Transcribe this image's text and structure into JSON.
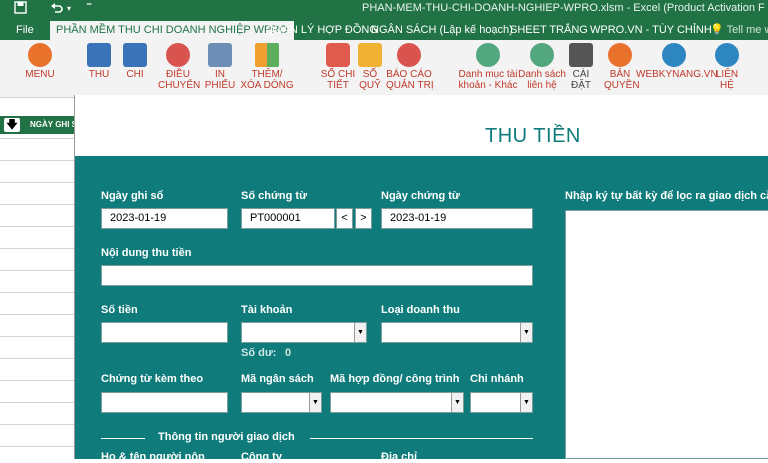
{
  "titlebar": {
    "save_icon": "save-icon",
    "undo_icon": "undo-icon",
    "title": "PHAN-MEM-THU-CHI-DOANH-NGHIEP-WPRO.xlsm - Excel (Product Activation F"
  },
  "tabs": [
    {
      "label": "File"
    },
    {
      "label": "PHẦN MỀM THU CHI DOANH NGHIỆP WPRO"
    },
    {
      "label": "QUẢN LÝ HỢP ĐỒNG"
    },
    {
      "label": "NGÂN SÁCH (Lập kế hoạch)"
    },
    {
      "label": "SHEET TRẮNG"
    },
    {
      "label": "WPRO.VN - TÙY CHỈNH"
    },
    {
      "label": "Tell me wha"
    }
  ],
  "ribbon": [
    {
      "label": "MENU",
      "icon": "menu-icon"
    },
    {
      "label": "THU",
      "icon": "monitor-icon"
    },
    {
      "label": "CHI",
      "icon": "monitor-icon"
    },
    {
      "label": "ĐIỀU\nCHUYỂN",
      "icon": "transfer-icon"
    },
    {
      "label": "IN\nPHIẾU",
      "icon": "printer-icon"
    },
    {
      "label": "THÊM/\nXÓA DÒNG",
      "icon": "grid-icon"
    },
    {
      "label": "SỔ CHI\nTIẾT",
      "icon": "document-icon"
    },
    {
      "label": "SỔ\nQUỸ",
      "icon": "folder-icon"
    },
    {
      "label": "BÁO CÁO\nQUẢN TRỊ",
      "icon": "chart-icon"
    },
    {
      "label": "Danh mục tài\nkhoản - Khác",
      "icon": "list-icon"
    },
    {
      "label": "Danh sách\nliên hệ",
      "icon": "list-icon"
    },
    {
      "label": "CÀI\nĐẶT",
      "icon": "settings-icon"
    },
    {
      "label": "BẢN\nQUYỀN",
      "icon": "license-icon"
    },
    {
      "label": "WEBKYNANG.VN",
      "icon": "globe-icon"
    },
    {
      "label": "LIÊN\nHỆ",
      "icon": "contact-icon"
    }
  ],
  "sheet": {
    "column_header": "NGÀY GHI S"
  },
  "form": {
    "title": "THU TIỀN",
    "labels": {
      "ngay_ghi_so": "Ngày ghi sổ",
      "so_chung_tu": "Số chứng từ",
      "ngay_chung_tu": "Ngày chứng từ",
      "noi_dung": "Nội dung thu tiền",
      "so_tien": "Số tiền",
      "tai_khoan": "Tài khoản",
      "loai_doanh_thu": "Loại doanh thu",
      "so_du": "Số dư:",
      "so_du_value": "0",
      "chung_tu_kem_theo": "Chứng từ kèm theo",
      "ma_ngan_sach": "Mã ngân sách",
      "ma_hop_dong": "Mã hợp đồng/ công trình",
      "chi_nhanh": "Chi nhánh",
      "thong_tin": "Thông tin người giao dịch",
      "ho_ten": "Họ & tên người nộp",
      "cong_ty": "Công ty",
      "dia_chi": "Địa chỉ",
      "filter_hint": "Nhập ký tự bất kỳ để lọc ra giao dịch cầ"
    },
    "values": {
      "ngay_ghi_so": "2023-01-19",
      "so_chung_tu": "PT000001",
      "ngay_chung_tu": "2023-01-19",
      "prev": "<",
      "next": ">"
    }
  }
}
